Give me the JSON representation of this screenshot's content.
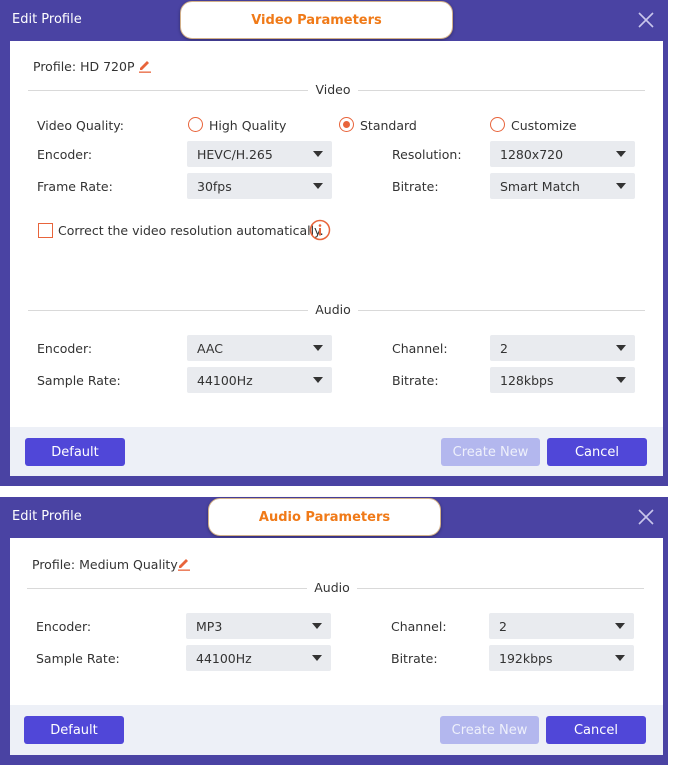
{
  "video_dialog": {
    "title": "Edit Profile",
    "tag": "Video Parameters",
    "profile_label": "Profile:",
    "profile_value": "HD 720P",
    "video_section": "Video",
    "video_quality_label": "Video Quality:",
    "quality_options": [
      "High Quality",
      "Standard",
      "Customize"
    ],
    "quality_selected": "Standard",
    "encoder_label": "Encoder:",
    "encoder_value": "HEVC/H.265",
    "resolution_label": "Resolution:",
    "resolution_value": "1280x720",
    "frame_rate_label": "Frame Rate:",
    "frame_rate_value": "30fps",
    "bitrate_label": "Bitrate:",
    "bitrate_value": "Smart Match",
    "correct_resolution_label": "Correct the video resolution automatically.",
    "audio_section": "Audio",
    "audio_encoder_label": "Encoder:",
    "audio_encoder_value": "AAC",
    "channel_label": "Channel:",
    "channel_value": "2",
    "sample_rate_label": "Sample Rate:",
    "sample_rate_value": "44100Hz",
    "audio_bitrate_label": "Bitrate:",
    "audio_bitrate_value": "128kbps",
    "default_button": "Default",
    "create_new_button": "Create New",
    "cancel_button": "Cancel"
  },
  "audio_dialog": {
    "title": "Edit Profile",
    "tag": "Audio Parameters",
    "profile_label": "Profile:",
    "profile_value": "Medium Quality",
    "audio_section": "Audio",
    "encoder_label": "Encoder:",
    "encoder_value": "MP3",
    "channel_label": "Channel:",
    "channel_value": "2",
    "sample_rate_label": "Sample Rate:",
    "sample_rate_value": "44100Hz",
    "bitrate_label": "Bitrate:",
    "bitrate_value": "192kbps",
    "default_button": "Default",
    "create_new_button": "Create New",
    "cancel_button": "Cancel"
  },
  "icons": {
    "close": "close-icon",
    "edit": "pencil-icon",
    "info": "info-icon",
    "dropdown": "chevron-down-icon"
  },
  "colors": {
    "frame": "#4a43a3",
    "accent": "#e8643b",
    "tag_text": "#f07a18",
    "primary_button": "#5047d8",
    "disabled_button": "#b3b7ee"
  }
}
